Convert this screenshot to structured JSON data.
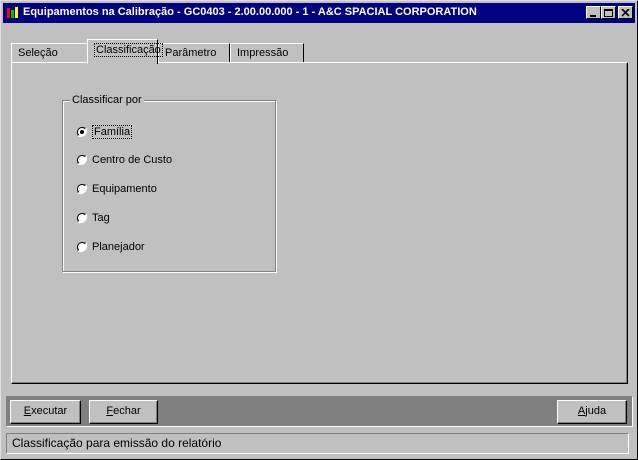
{
  "window": {
    "title": "Equipamentos na Calibração - GC0403 - 2.00.00.000 - 1 - A&C SPACIAL CORPORATION",
    "minimize_icon": "minimize-icon",
    "maximize_icon": "maximize-icon",
    "close_icon": "close-icon"
  },
  "tabs": [
    {
      "label": "Seleção",
      "active": false
    },
    {
      "label": "Classificação",
      "active": true
    },
    {
      "label": "Parâmetro",
      "active": false
    },
    {
      "label": "Impressão",
      "active": false
    }
  ],
  "classify": {
    "group_label": "Classificar por",
    "options": [
      {
        "label": "Família",
        "selected": true
      },
      {
        "label": "Centro de Custo",
        "selected": false
      },
      {
        "label": "Equipamento",
        "selected": false
      },
      {
        "label": "Tag",
        "selected": false
      },
      {
        "label": "Planejador",
        "selected": false
      }
    ]
  },
  "buttons": {
    "execute": {
      "mnemonic": "E",
      "rest": "xecutar"
    },
    "close": {
      "mnemonic": "F",
      "rest": "echar"
    },
    "help": {
      "mnemonic": "A",
      "rest": "juda"
    }
  },
  "status": {
    "text": "Classificação para emissão do relatório"
  },
  "colors": {
    "titlebar": "#000080",
    "face": "#c0c0c0",
    "shadow": "#808080"
  }
}
